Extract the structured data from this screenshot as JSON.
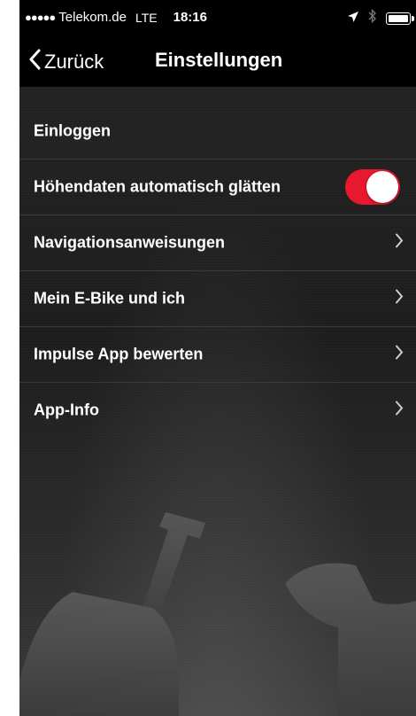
{
  "status_bar": {
    "signal_dots": "●●●●●",
    "carrier": "Telekom.de",
    "network": "LTE",
    "time": "18:16"
  },
  "nav": {
    "back_label": "Zurück",
    "title": "Einstellungen"
  },
  "settings": {
    "login": "Einloggen",
    "smoothing": "Höhendaten automatisch glätten",
    "smoothing_enabled": true,
    "navigation": "Navigationsanweisungen",
    "ebike": "Mein E-Bike und ich",
    "rate": "Impulse App bewerten",
    "info": "App-Info"
  },
  "colors": {
    "accent": "#e8182e",
    "bar": "#000000",
    "background": "#1d1d1d"
  },
  "icons": {
    "back": "chevron-left-icon",
    "disclosure": "chevron-right-icon",
    "location": "location-arrow-icon",
    "bluetooth": "bluetooth-icon",
    "battery": "battery-icon"
  }
}
